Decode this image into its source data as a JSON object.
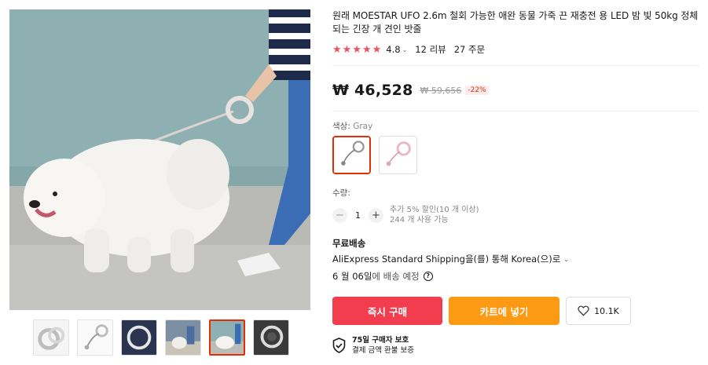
{
  "product": {
    "title": "원래 MOESTAR UFO 2.6m 철회 가능한 애완 동물 가죽 끈 재충전 용 LED 밤 빛 50kg 정체 되는 긴장 개 견인 밧줄",
    "rating": "4.8",
    "rating_chevron": "⌄",
    "reviews": "12 리뷰",
    "orders": "27 주문",
    "price": "₩ 46,528",
    "original_price": "₩ 59,656",
    "discount": "-22%"
  },
  "color": {
    "label": "색상: ",
    "value": "Gray"
  },
  "quantity": {
    "label": "수량:",
    "value": "1",
    "minus": "−",
    "plus": "+",
    "note_line1": "추가 5% 할인(10 개 이상)",
    "note_line2": "244 개 사용 가능"
  },
  "shipping": {
    "title": "무료배송",
    "method": "AliExpress Standard Shipping을(를) 통해 Korea(으)로",
    "chevron": "⌄",
    "delivery_date": "6 월 06일",
    "delivery_suffix": "에 배송 예정",
    "help": "?"
  },
  "actions": {
    "buy_now": "즉시 구매",
    "add_to_cart": "카트에 넣기",
    "wishlist_count": "10.1K"
  },
  "protection": {
    "line1": "75일 구매자 보호",
    "line2": "결제 금액 환불 보증"
  },
  "colors": {
    "accent": "#e62e04",
    "star": "#f0505e",
    "buy_button": "#f23d4f",
    "cart_button": "#fd9a13",
    "background_wall": "#8fb0b3"
  },
  "icons": {
    "star": "star-icon",
    "heart": "heart-icon",
    "shield": "shield-check-icon",
    "help": "question-circle-icon"
  }
}
